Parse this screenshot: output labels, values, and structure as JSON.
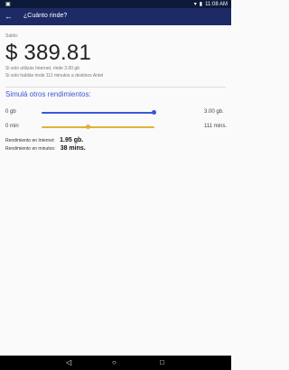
{
  "status_bar": {
    "time": "11:08 AM",
    "left_icon": "notification-icon"
  },
  "app_bar": {
    "title": "¿Cuánto rinde?"
  },
  "balance": {
    "label": "Saldo:",
    "amount": "$ 389.81",
    "note_internet": "Si solo utilizás Internet, rinde 3.00 gb",
    "note_calls": "Si solo hablás rinde 111 minutos a destinos Antel"
  },
  "simulate": {
    "title": "Simulá otros rendimientos:",
    "data_slider": {
      "min_label": "0 gb",
      "max_label": "3.00 gb.",
      "level": 0.98
    },
    "minutes_slider": {
      "min_label": "0 min",
      "max_label": "111 mins.",
      "level": 0.4
    },
    "result_internet_label": "Rendimiento en Internet:",
    "result_internet_value": "1.95 gb.",
    "result_minutes_label": "Rendimiento en minutos:",
    "result_minutes_value": "38 mins."
  },
  "colors": {
    "appbar": "#1e2a66",
    "accent_blue": "#3a57d6",
    "accent_yellow": "#e0b13a"
  },
  "nav": {
    "back_icon": "nav-back-icon",
    "home_icon": "nav-home-icon",
    "recent_icon": "nav-recent-icon"
  }
}
